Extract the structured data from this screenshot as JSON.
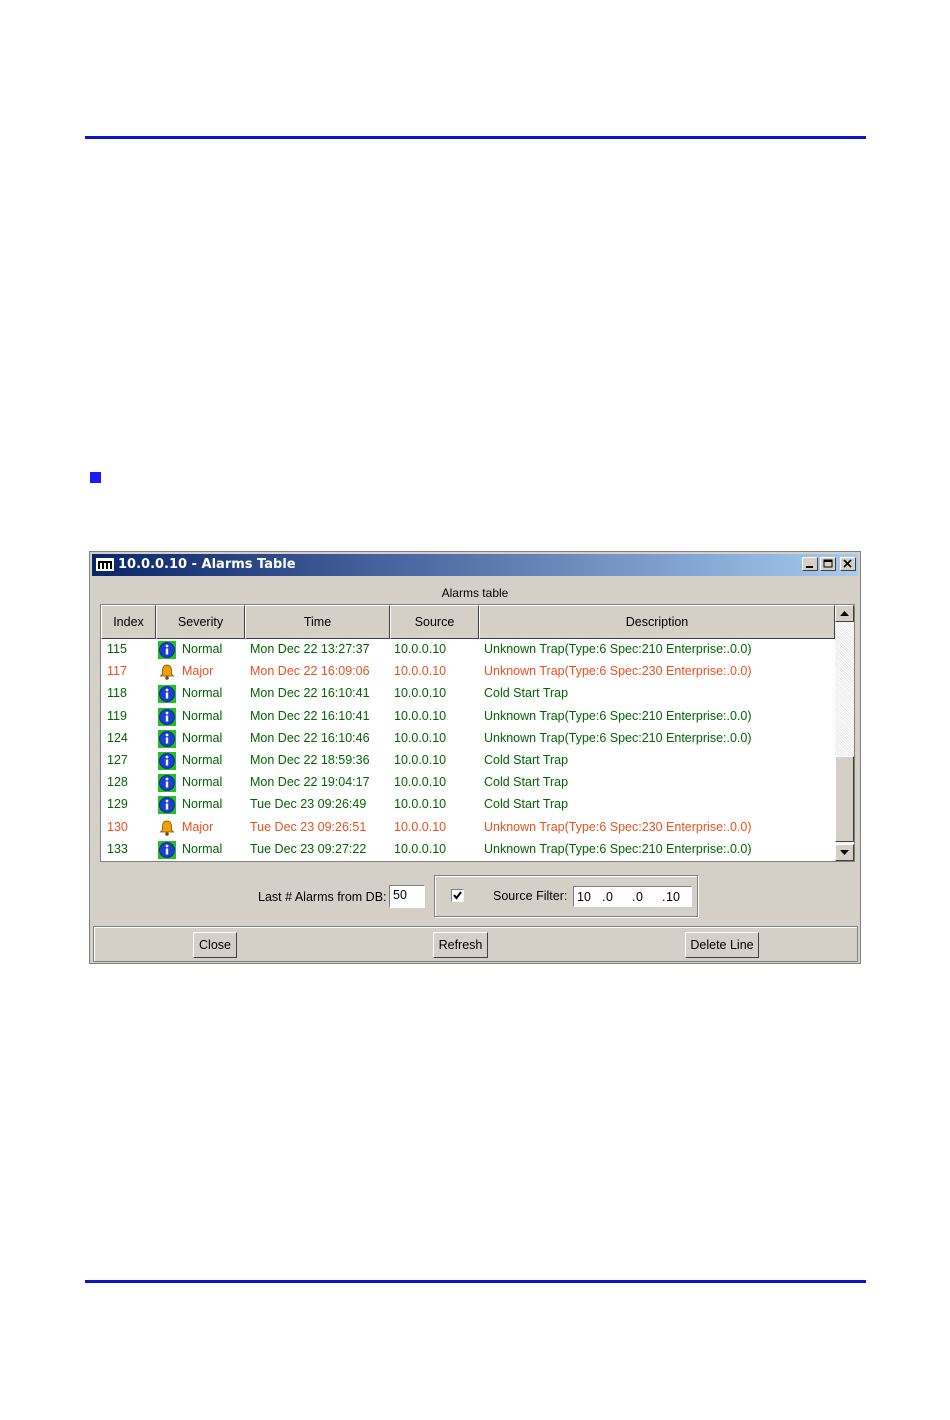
{
  "window": {
    "title": "10.0.0.10 - Alarms Table"
  },
  "group_caption": "Alarms table",
  "columns": [
    "Index",
    "Severity",
    "Time",
    "Source",
    "Description"
  ],
  "rows": [
    {
      "index": "115",
      "severity": "Normal",
      "time": "Mon Dec 22 13:27:37",
      "source": "10.0.0.10",
      "description": "Unknown Trap(Type:6 Spec:210 Enterprise:.0.0)"
    },
    {
      "index": "117",
      "severity": "Major",
      "time": "Mon Dec 22 16:09:06",
      "source": "10.0.0.10",
      "description": "Unknown Trap(Type:6 Spec:230 Enterprise:.0.0)"
    },
    {
      "index": "118",
      "severity": "Normal",
      "time": "Mon Dec 22 16:10:41",
      "source": "10.0.0.10",
      "description": "Cold Start Trap"
    },
    {
      "index": "119",
      "severity": "Normal",
      "time": "Mon Dec 22 16:10:41",
      "source": "10.0.0.10",
      "description": "Unknown Trap(Type:6 Spec:210 Enterprise:.0.0)"
    },
    {
      "index": "124",
      "severity": "Normal",
      "time": "Mon Dec 22 16:10:46",
      "source": "10.0.0.10",
      "description": "Unknown Trap(Type:6 Spec:210 Enterprise:.0.0)"
    },
    {
      "index": "127",
      "severity": "Normal",
      "time": "Mon Dec 22 18:59:36",
      "source": "10.0.0.10",
      "description": "Cold Start Trap"
    },
    {
      "index": "128",
      "severity": "Normal",
      "time": "Mon Dec 22 19:04:17",
      "source": "10.0.0.10",
      "description": "Cold Start Trap"
    },
    {
      "index": "129",
      "severity": "Normal",
      "time": "Tue Dec 23 09:26:49",
      "source": "10.0.0.10",
      "description": "Cold Start Trap"
    },
    {
      "index": "130",
      "severity": "Major",
      "time": "Tue Dec 23 09:26:51",
      "source": "10.0.0.10",
      "description": "Unknown Trap(Type:6 Spec:230 Enterprise:.0.0)"
    },
    {
      "index": "133",
      "severity": "Normal",
      "time": "Tue Dec 23 09:27:22",
      "source": "10.0.0.10",
      "description": "Unknown Trap(Type:6 Spec:210 Enterprise:.0.0)"
    }
  ],
  "controls": {
    "last_alarms_label": "Last # Alarms from DB:",
    "last_alarms_value": "50",
    "source_filter_checked": true,
    "source_filter_label": "Source Filter:",
    "ip": [
      "10",
      "0",
      "0",
      "10"
    ],
    "ip_dot": "."
  },
  "buttons": {
    "close": "Close",
    "refresh": "Refresh",
    "delete_line": "Delete Line"
  },
  "colors": {
    "normal": "#006400",
    "major": "#e8501e",
    "accent_rule": "#0a14c8",
    "title_bar": "#0a246a"
  }
}
